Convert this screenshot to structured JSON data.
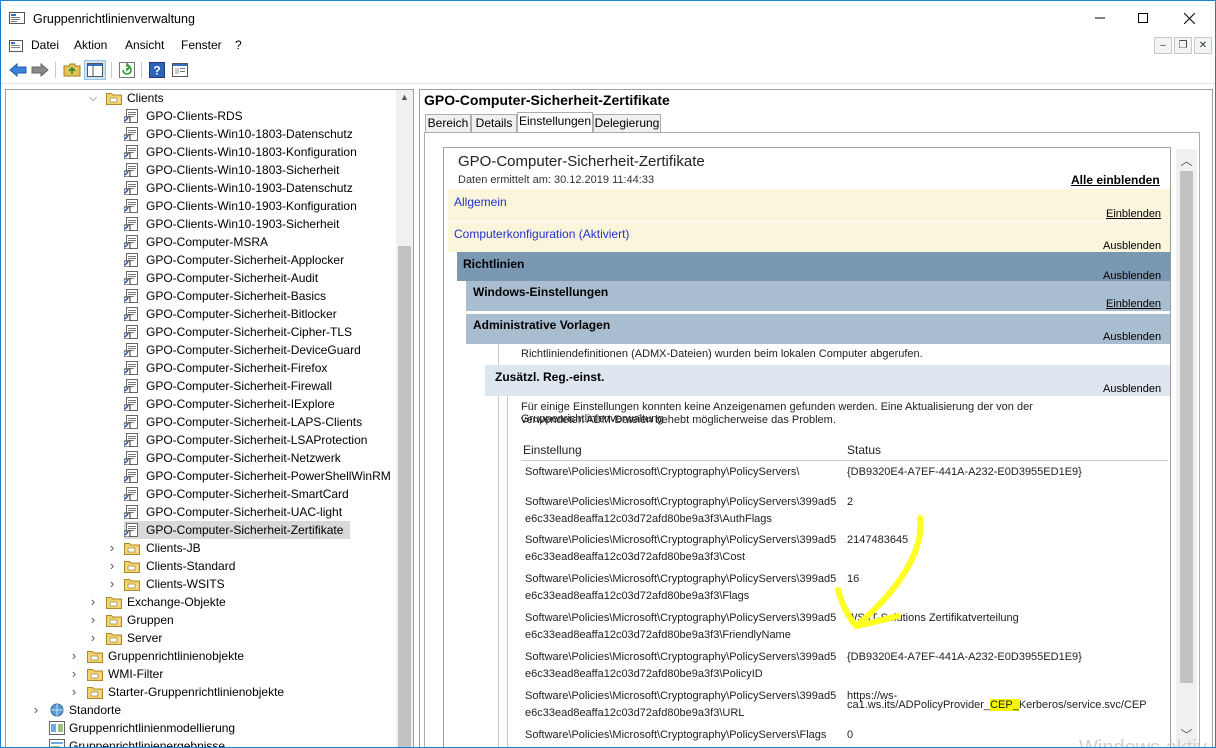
{
  "window": {
    "title": "Gruppenrichtlinienverwaltung",
    "minimize": "—",
    "maximize": "☐",
    "close": "✕"
  },
  "menu": [
    "Datei",
    "Aktion",
    "Ansicht",
    "Fenster",
    "?"
  ],
  "tree": {
    "items": [
      {
        "label": "Clients",
        "type": "folder",
        "expanded": true
      },
      {
        "label": "GPO-Clients-RDS",
        "type": "gpo"
      },
      {
        "label": "GPO-Clients-Win10-1803-Datenschutz",
        "type": "gpo"
      },
      {
        "label": "GPO-Clients-Win10-1803-Konfiguration",
        "type": "gpo"
      },
      {
        "label": "GPO-Clients-Win10-1803-Sicherheit",
        "type": "gpo"
      },
      {
        "label": "GPO-Clients-Win10-1903-Datenschutz",
        "type": "gpo"
      },
      {
        "label": "GPO-Clients-Win10-1903-Konfiguration",
        "type": "gpo"
      },
      {
        "label": "GPO-Clients-Win10-1903-Sicherheit",
        "type": "gpo"
      },
      {
        "label": "GPO-Computer-MSRA",
        "type": "gpo"
      },
      {
        "label": "GPO-Computer-Sicherheit-Applocker",
        "type": "gpo"
      },
      {
        "label": "GPO-Computer-Sicherheit-Audit",
        "type": "gpo"
      },
      {
        "label": "GPO-Computer-Sicherheit-Basics",
        "type": "gpo"
      },
      {
        "label": "GPO-Computer-Sicherheit-Bitlocker",
        "type": "gpo"
      },
      {
        "label": "GPO-Computer-Sicherheit-Cipher-TLS",
        "type": "gpo"
      },
      {
        "label": "GPO-Computer-Sicherheit-DeviceGuard",
        "type": "gpo"
      },
      {
        "label": "GPO-Computer-Sicherheit-Firefox",
        "type": "gpo"
      },
      {
        "label": "GPO-Computer-Sicherheit-Firewall",
        "type": "gpo"
      },
      {
        "label": "GPO-Computer-Sicherheit-IExplore",
        "type": "gpo"
      },
      {
        "label": "GPO-Computer-Sicherheit-LAPS-Clients",
        "type": "gpo"
      },
      {
        "label": "GPO-Computer-Sicherheit-LSAProtection",
        "type": "gpo"
      },
      {
        "label": "GPO-Computer-Sicherheit-Netzwerk",
        "type": "gpo"
      },
      {
        "label": "GPO-Computer-Sicherheit-PowerShellWinRM",
        "type": "gpo"
      },
      {
        "label": "GPO-Computer-Sicherheit-SmartCard",
        "type": "gpo"
      },
      {
        "label": "GPO-Computer-Sicherheit-UAC-light",
        "type": "gpo"
      },
      {
        "label": "GPO-Computer-Sicherheit-Zertifikate",
        "type": "gpo",
        "selected": true
      },
      {
        "label": "Clients-JB",
        "type": "folder"
      },
      {
        "label": "Clients-Standard",
        "type": "folder"
      },
      {
        "label": "Clients-WSITS",
        "type": "folder"
      },
      {
        "label": "Exchange-Objekte",
        "type": "folder"
      },
      {
        "label": "Gruppen",
        "type": "folder"
      },
      {
        "label": "Server",
        "type": "folder"
      },
      {
        "label": "Gruppenrichtlinienobjekte",
        "type": "folder"
      },
      {
        "label": "WMI-Filter",
        "type": "folder"
      },
      {
        "label": "Starter-Gruppenrichtlinienobjekte",
        "type": "folder"
      },
      {
        "label": "Standorte",
        "type": "site"
      },
      {
        "label": "Gruppenrichtlinienmodellierung",
        "type": "model"
      },
      {
        "label": "Gruppenrichtlinienergebnisse",
        "type": "result"
      }
    ]
  },
  "right": {
    "title": "GPO-Computer-Sicherheit-Zertifikate",
    "tabs": [
      "Bereich",
      "Details",
      "Einstellungen",
      "Delegierung"
    ],
    "active_tab": "Einstellungen"
  },
  "report": {
    "title": "GPO-Computer-Sicherheit-Zertifikate",
    "date": "Daten ermittelt am: 30.12.2019 11:44:33",
    "show_all": "Alle einblenden",
    "allgemein": "Allgemein",
    "allgemein_link": "Einblenden",
    "computer": "Computerkonfiguration (Aktiviert)",
    "computer_link": "Ausblenden",
    "richtlinien": "Richtlinien",
    "richtlinien_link": "Ausblenden",
    "windows": "Windows-Einstellungen",
    "windows_link": "Einblenden",
    "admin": "Administrative Vorlagen",
    "admin_link": "Ausblenden",
    "admx_note": "Richtliniendefinitionen (ADMX-Dateien) wurden beim lokalen Computer abgerufen.",
    "zusatz": "Zusätzl. Reg.-einst.",
    "zusatz_link": "Ausblenden",
    "note_line1": "Für einige Einstellungen konnten keine Anzeigenamen gefunden werden. Eine Aktualisierung der von der Gruppenrichtlinienverwaltung",
    "note_line2": "verwendeten ADM-Dateien behebt möglicherweise das Problem.",
    "col_setting": "Einstellung",
    "col_status": "Status",
    "rows": [
      {
        "k1": "Software\\Policies\\Microsoft\\Cryptography\\PolicyServers\\",
        "k2": "",
        "v1": "{DB9320E4-A7EF-441A-A232-E0D3955ED1E9}",
        "v2": ""
      },
      {
        "k1": "Software\\Policies\\Microsoft\\Cryptography\\PolicyServers\\399ad5",
        "k2": "e6c33ead8eaffa12c03d72afd80be9a3f3\\AuthFlags",
        "v1": "2",
        "v2": ""
      },
      {
        "k1": "Software\\Policies\\Microsoft\\Cryptography\\PolicyServers\\399ad5",
        "k2": "e6c33ead8eaffa12c03d72afd80be9a3f3\\Cost",
        "v1": "2147483645",
        "v2": ""
      },
      {
        "k1": "Software\\Policies\\Microsoft\\Cryptography\\PolicyServers\\399ad5",
        "k2": "e6c33ead8eaffa12c03d72afd80be9a3f3\\Flags",
        "v1": "16",
        "v2": ""
      },
      {
        "k1": "Software\\Policies\\Microsoft\\Cryptography\\PolicyServers\\399ad5",
        "k2": "e6c33ead8eaffa12c03d72afd80be9a3f3\\FriendlyName",
        "v1": "WS IT-Solutions Zertifikatverteilung",
        "v2": ""
      },
      {
        "k1": "Software\\Policies\\Microsoft\\Cryptography\\PolicyServers\\399ad5",
        "k2": "e6c33ead8eaffa12c03d72afd80be9a3f3\\PolicyID",
        "v1": "{DB9320E4-A7EF-441A-A232-E0D3955ED1E9}",
        "v2": ""
      },
      {
        "k1": "Software\\Policies\\Microsoft\\Cryptography\\PolicyServers\\399ad5",
        "k2": "e6c33ead8eaffa12c03d72afd80be9a3f3\\URL",
        "v1": "https://ws-",
        "v2": ""
      },
      {
        "k1": "Software\\Policies\\Microsoft\\Cryptography\\PolicyServers\\Flags",
        "k2": "",
        "v1": "0",
        "v2": ""
      }
    ],
    "url_line2_pre": "ca1.ws.its/ADPolicyProvider_",
    "url_line2_hl": "CEP_",
    "url_line2_post": "Kerberos/service.svc/CEP"
  },
  "watermark": "Windows aktiv",
  "colors": {
    "section_yellow": "#fbf5dc",
    "richtlinien_blue": "#7b98b3",
    "subsection_blue": "#a9bdd0",
    "light_subsection": "#dde5ee",
    "link_blue": "#2233cc",
    "annotation_yellow": "#ffff22"
  }
}
